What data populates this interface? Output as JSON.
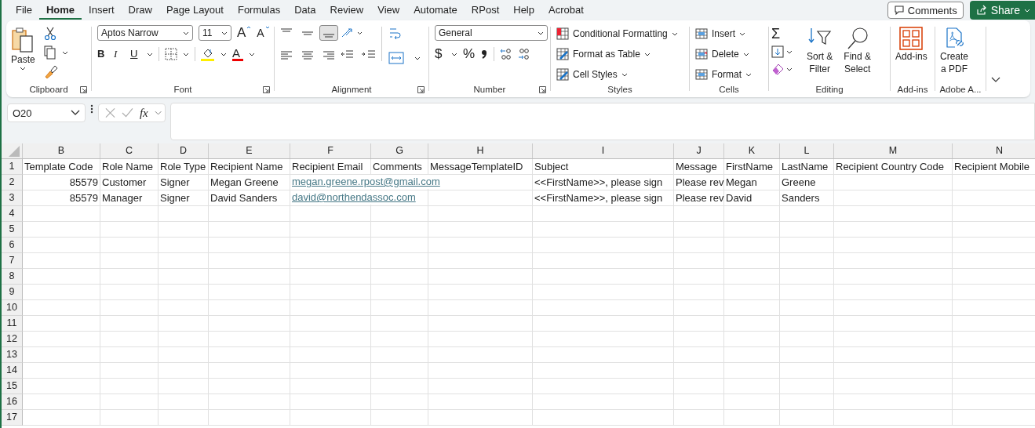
{
  "menu_tabs": [
    {
      "label": "File",
      "selected": false
    },
    {
      "label": "Home",
      "selected": true
    },
    {
      "label": "Insert",
      "selected": false
    },
    {
      "label": "Draw",
      "selected": false
    },
    {
      "label": "Page Layout",
      "selected": false
    },
    {
      "label": "Formulas",
      "selected": false
    },
    {
      "label": "Data",
      "selected": false
    },
    {
      "label": "Review",
      "selected": false
    },
    {
      "label": "View",
      "selected": false
    },
    {
      "label": "Automate",
      "selected": false
    },
    {
      "label": "RPost",
      "selected": false
    },
    {
      "label": "Help",
      "selected": false
    },
    {
      "label": "Acrobat",
      "selected": false
    }
  ],
  "comments_button": "Comments",
  "share_button": "Share",
  "ribbon": {
    "clipboard": {
      "paste": "Paste",
      "label": "Clipboard"
    },
    "font": {
      "name": "Aptos Narrow",
      "size": "11",
      "grow": "A",
      "shrink": "A",
      "bold": "B",
      "italic": "I",
      "underline": "U",
      "font_color": "A",
      "label": "Font"
    },
    "alignment": {
      "buttons": [
        {
          "selected": false
        },
        {
          "selected": false
        },
        {
          "selected": true
        },
        {
          "selected": false
        },
        {
          "selected": false
        },
        {
          "selected": false
        }
      ],
      "label": "Alignment"
    },
    "number": {
      "format": "General",
      "currency": "$",
      "percent": "%",
      "label": "Number"
    },
    "styles": {
      "items": [
        "Conditional Formatting",
        "Format as Table",
        "Cell Styles"
      ],
      "label": "Styles"
    },
    "cells": {
      "items": [
        "Insert",
        "Delete",
        "Format"
      ],
      "label": "Cells"
    },
    "editing": {
      "sum": "Σ",
      "sort": [
        "Sort &",
        "Filter"
      ],
      "find": [
        "Find &",
        "Select"
      ],
      "label": "Editing"
    },
    "addins": {
      "button": "Add-ins",
      "label": "Add-ins"
    },
    "adobe": {
      "button": [
        "Create",
        "a PDF"
      ],
      "label": "Adobe A..."
    }
  },
  "formula_bar": {
    "name_box": "O20",
    "fx": "fx"
  },
  "sheet": {
    "columns": [
      "B",
      "C",
      "D",
      "E",
      "F",
      "G",
      "H",
      "I",
      "J",
      "K",
      "L",
      "M",
      "N"
    ],
    "rows": [
      {
        "number": "1",
        "cells": {
          "B": {
            "text": "Template Code",
            "kind": "text"
          },
          "C": {
            "text": "Role Name",
            "kind": "text"
          },
          "D": {
            "text": "Role Type",
            "kind": "text"
          },
          "E": {
            "text": "Recipient Name",
            "kind": "text"
          },
          "F": {
            "text": "Recipient Email",
            "kind": "text"
          },
          "G": {
            "text": "Comments",
            "kind": "text"
          },
          "H": {
            "text": "MessageTemplateID",
            "kind": "text"
          },
          "I": {
            "text": "Subject",
            "kind": "text"
          },
          "J": {
            "text": "Message",
            "kind": "text"
          },
          "K": {
            "text": "FirstName",
            "kind": "text"
          },
          "L": {
            "text": "LastName",
            "kind": "text"
          },
          "M": {
            "text": "Recipient Country Code",
            "kind": "text"
          },
          "N": {
            "text": "Recipient Mobile",
            "kind": "text"
          }
        }
      },
      {
        "number": "2",
        "cells": {
          "B": {
            "text": "85579",
            "kind": "number"
          },
          "C": {
            "text": "Customer",
            "kind": "text"
          },
          "D": {
            "text": "Signer",
            "kind": "text"
          },
          "E": {
            "text": "Megan Greene",
            "kind": "text"
          },
          "F": {
            "text": "megan.greene.rpost@gmail.com",
            "kind": "link"
          },
          "I": {
            "text": "<<FirstName>>, please sign",
            "kind": "text"
          },
          "J": {
            "text": "Please rev",
            "kind": "text"
          },
          "K": {
            "text": "Megan",
            "kind": "text"
          },
          "L": {
            "text": "Greene",
            "kind": "text"
          }
        }
      },
      {
        "number": "3",
        "cells": {
          "B": {
            "text": "85579",
            "kind": "number"
          },
          "C": {
            "text": "Manager",
            "kind": "text"
          },
          "D": {
            "text": "Signer",
            "kind": "text"
          },
          "E": {
            "text": "David Sanders",
            "kind": "text"
          },
          "F": {
            "text": "david@northendassoc.com",
            "kind": "link"
          },
          "I": {
            "text": "<<FirstName>>, please sign",
            "kind": "text"
          },
          "J": {
            "text": "Please rev",
            "kind": "text"
          },
          "K": {
            "text": "David",
            "kind": "text"
          },
          "L": {
            "text": "Sanders",
            "kind": "text"
          }
        }
      },
      {
        "number": "4"
      },
      {
        "number": "5"
      },
      {
        "number": "6"
      },
      {
        "number": "7"
      },
      {
        "number": "8"
      },
      {
        "number": "9"
      },
      {
        "number": "10"
      },
      {
        "number": "11"
      },
      {
        "number": "12"
      },
      {
        "number": "13"
      },
      {
        "number": "14"
      },
      {
        "number": "15"
      },
      {
        "number": "16"
      },
      {
        "number": "17"
      }
    ]
  }
}
